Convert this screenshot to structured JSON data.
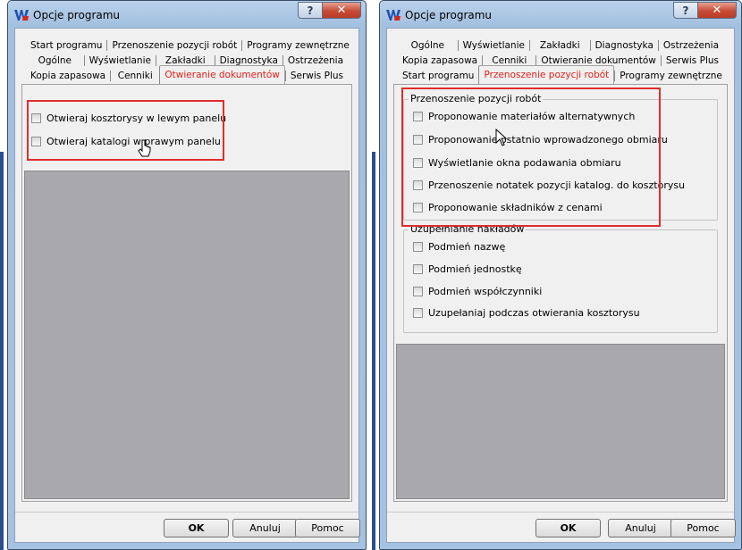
{
  "windows": [
    {
      "title": "Opcje programu",
      "tab_rows": [
        [
          "Start programu",
          "Przenoszenie pozycji robót",
          "Programy zewnętrzne"
        ],
        [
          "Ogólne",
          "Wyświetlanie",
          "Zakładki",
          "Diagnostyka",
          "Ostrzeżenia"
        ],
        [
          "Kopia zapasowa",
          "Cenniki",
          "Otwieranie dokumentów",
          "Serwis Plus"
        ]
      ],
      "active_tab": "Otwieranie dokumentów",
      "options": [
        {
          "label": "Otwieraj kosztorysy w lewym panelu",
          "checked": false
        },
        {
          "label": "Otwieraj katalogi w prawym panelu",
          "checked": false
        }
      ],
      "buttons": {
        "ok": "OK",
        "cancel": "Anuluj",
        "help": "Pomoc"
      }
    },
    {
      "title": "Opcje programu",
      "tab_rows": [
        [
          "Ogólne",
          "Wyświetlanie",
          "Zakładki",
          "Diagnostyka",
          "Ostrzeżenia"
        ],
        [
          "Kopia zapasowa",
          "Cenniki",
          "Otwieranie dokumentów",
          "Serwis Plus"
        ],
        [
          "Start programu",
          "Przenoszenie pozycji robót",
          "Programy zewnętrzne"
        ]
      ],
      "active_tab": "Przenoszenie pozycji robót",
      "group1": {
        "title": "Przenoszenie pozycji robót",
        "options": [
          {
            "label": "Proponowanie materiałów alternatywnych",
            "checked": false
          },
          {
            "label": "Proponowanie ostatnio wprowadzonego obmiaru",
            "checked": false
          },
          {
            "label": "Wyświetlanie okna podawania obmiaru",
            "checked": false
          },
          {
            "label": "Przenoszenie notatek pozycji katalog. do kosztorysu",
            "checked": false
          },
          {
            "label": "Proponowanie składników z cenami",
            "checked": false
          }
        ]
      },
      "group2": {
        "title": "Uzupełnianie nakładów",
        "options": [
          {
            "label": "Podmień nazwę",
            "checked": false
          },
          {
            "label": "Podmień jednostkę",
            "checked": false
          },
          {
            "label": "Podmień współczynniki",
            "checked": false
          },
          {
            "label": "Uzupełaniaj podczas otwierania kosztorysu",
            "checked": false
          }
        ]
      },
      "buttons": {
        "ok": "OK",
        "cancel": "Anuluj",
        "help": "Pomoc"
      }
    }
  ],
  "colors": {
    "active_tab_text": "#e0201a",
    "highlight_box": "#e02d2d",
    "disabled_panel": "#a9a9ad"
  }
}
